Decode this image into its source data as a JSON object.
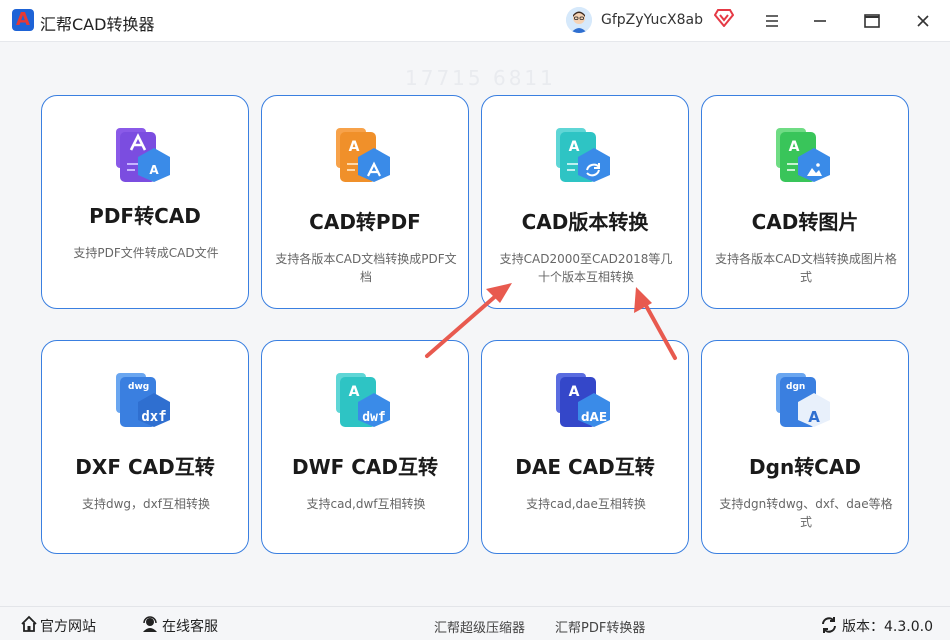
{
  "app": {
    "title": "汇帮CAD转换器",
    "username": "GfpZyYucX8ab"
  },
  "watermark": "17715 6811",
  "cards": [
    {
      "title": "PDF转CAD",
      "desc": "支持PDF文件转成CAD文件",
      "badge": "",
      "icon": "pdf-to-cad-icon",
      "color": "#7b4de0"
    },
    {
      "title": "CAD转PDF",
      "desc": "支持各版本CAD文档转换成PDF文档",
      "badge": "",
      "icon": "cad-to-pdf-icon",
      "color": "#f0902a"
    },
    {
      "title": "CAD版本转换",
      "desc": "支持CAD2000至CAD2018等几十个版本互相转换",
      "badge": "",
      "icon": "cad-version-convert-icon",
      "color": "#2ec4c4"
    },
    {
      "title": "CAD转图片",
      "desc": "支持各版本CAD文档转换成图片格式",
      "badge": "",
      "icon": "cad-to-image-icon",
      "color": "#39c55a"
    },
    {
      "title": "DXF CAD互转",
      "desc": "支持dwg，dxf互相转换",
      "badge": "dxf",
      "icon": "dxf-convert-icon",
      "color": "#3a7fe0"
    },
    {
      "title": "DWF CAD互转",
      "desc": "支持cad,dwf互相转换",
      "badge": "dwf",
      "icon": "dwf-convert-icon",
      "color": "#2ec4c4"
    },
    {
      "title": "DAE CAD互转",
      "desc": "支持cad,dae互相转换",
      "badge": "dAE",
      "icon": "dae-convert-icon",
      "color": "#3447c9"
    },
    {
      "title": "Dgn转CAD",
      "desc": "支持dgn转dwg、dxf、dae等格式",
      "badge": "A",
      "icon": "dgn-to-cad-icon",
      "color": "#3a7fe0"
    }
  ],
  "footer": {
    "website": "官方网站",
    "service": "在线客服",
    "link1": "汇帮超级压缩器",
    "link2": "汇帮PDF转换器",
    "version_label": "版本：4.3.0.0"
  },
  "colors": {
    "accent": "#3a7fe0",
    "arrow": "#e85a4f"
  }
}
